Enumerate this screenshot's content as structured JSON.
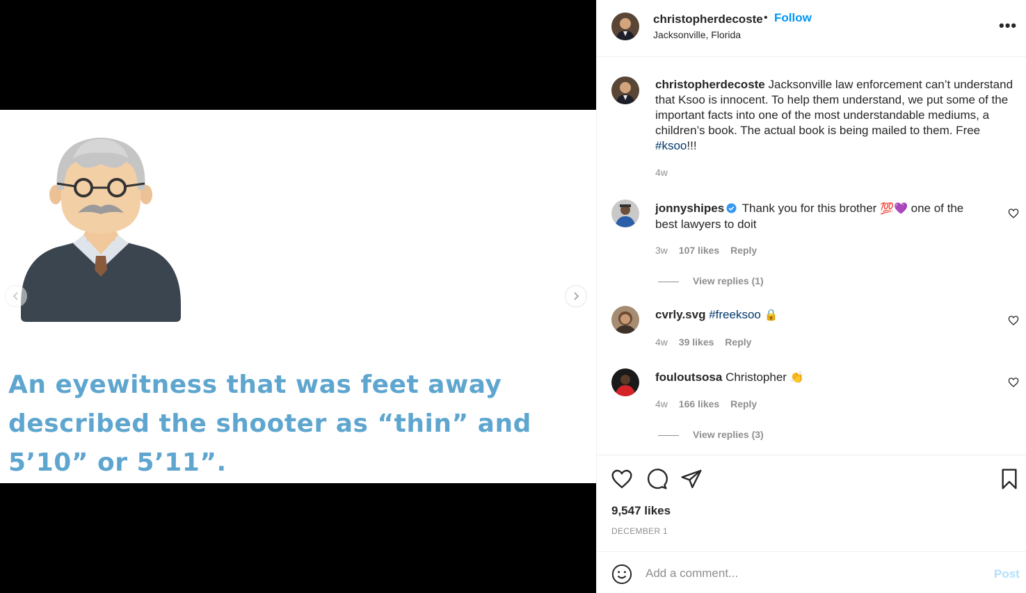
{
  "post": {
    "caption_image_text": "An eyewitness that was feet away described the shooter as “thin” and 5’10” or 5’11”.",
    "author": "christopherdecoste",
    "follow_label": "Follow",
    "location": "Jacksonville, Florida",
    "more_label": "•••",
    "caption": {
      "username": "christopherdecoste",
      "text": "Jacksonville law enforcement can’t understand that Ksoo is innocent. To help them understand, we put some of the important facts into one of the most understandable mediums, a children’s book. The actual book is being mailed to them. Free ",
      "hashtag": "#ksoo",
      "suffix": "!!!",
      "time": "4w"
    },
    "likes": "9,547 likes",
    "date": "DECEMBER 1"
  },
  "comments": [
    {
      "username": "jonnyshipes",
      "text": "Thank you for this brother",
      "emoji": "💯💜",
      "text2": " one of the best lawyers to doit",
      "time": "3w",
      "likes": "107 likes",
      "reply": "Reply",
      "view_replies": "View replies (1)"
    },
    {
      "username": "cvrly.svg",
      "hashtag": "#freeksoo",
      "emoji": "🔒",
      "time": "4w",
      "likes": "39 likes",
      "reply": "Reply"
    },
    {
      "username": "fouloutsosa",
      "text": "Christopher",
      "emoji": "👏",
      "time": "4w",
      "likes": "166 likes",
      "reply": "Reply",
      "view_replies": "View replies (3)"
    }
  ],
  "add_comment": {
    "placeholder": "Add a comment...",
    "post_label": "Post"
  },
  "colors": {
    "accent": "#0095f6",
    "caption_text": "#5ea6cf",
    "post_disabled": "#b2dffc"
  }
}
